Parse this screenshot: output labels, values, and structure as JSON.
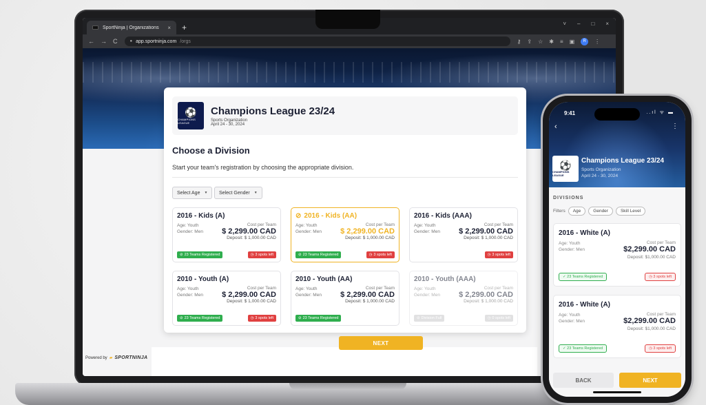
{
  "browser": {
    "tab_title": "SportNinja | Organizations",
    "tab_close": "×",
    "new_tab": "+",
    "url_host": "app.sportninja.com",
    "url_path": "/orgs",
    "nav": {
      "back": "←",
      "forward": "→",
      "reload": "C"
    },
    "window_controls": {
      "chevron": "˅",
      "minimize": "–",
      "maximize": "□",
      "close": "×"
    },
    "profile_initial": "R"
  },
  "org": {
    "title": "Champions League 23/24",
    "type": "Sports Organization",
    "dates": "April 24 - 30, 2024",
    "logo_text": "CHAMPIONS LEAGUE",
    "phone_logo_text": "CHAMPIONS LEAGUE"
  },
  "desktop": {
    "heading": "Choose a Division",
    "subheading": "Start your team's registration by choosing the appropriate division.",
    "filters": [
      {
        "label": "Select Age"
      },
      {
        "label": "Select Gender"
      }
    ],
    "divisions": [
      {
        "name": "2016 - Kids (A)",
        "age": "Age: Youth",
        "gender": "Gender: Men",
        "cost_label": "Cost per Team",
        "price": "$ 2,299.00 CAD",
        "deposit": "Deposit: $ 1,000.00 CAD",
        "teams_badge": "23 Teams Registered",
        "spots_badge": "3 spots left"
      },
      {
        "name": "2016 - Kids (AA)",
        "age": "Age: Youth",
        "gender": "Gender: Men",
        "cost_label": "Cost per Team",
        "price": "$ 2,299.00 CAD",
        "deposit": "Deposit: $ 1,000.00 CAD",
        "teams_badge": "23 Teams Registered",
        "spots_badge": "3 spots left"
      },
      {
        "name": "2016 - Kids (AAA)",
        "age": "Age: Youth",
        "gender": "Gender: Men",
        "cost_label": "Cost per Team",
        "price": "$ 2,299.00 CAD",
        "deposit": "Deposit: $ 1,000.00 CAD",
        "teams_badge": "",
        "spots_badge": "3 spots left"
      },
      {
        "name": "2010 - Youth (A)",
        "age": "Age: Youth",
        "gender": "Gender: Men",
        "cost_label": "Cost per Team",
        "price": "$ 2,299.00 CAD",
        "deposit": "Deposit: $ 1,000.00 CAD",
        "teams_badge": "23 Teams Registered",
        "spots_badge": "3 spots left"
      },
      {
        "name": "2010 - Youth (AA)",
        "age": "Age: Youth",
        "gender": "Gender: Men",
        "cost_label": "Cost per Team",
        "price": "$ 2,299.00 CAD",
        "deposit": "Deposit: $ 1,000.00 CAD",
        "teams_badge": "23 Teams Registered",
        "spots_badge": ""
      },
      {
        "name": "2010 - Youth (AAA)",
        "age": "Age: Youth",
        "gender": "Gender: Men",
        "cost_label": "Cost per Team",
        "price": "$ 2,299.00 CAD",
        "deposit": "Deposit: $ 1,000.00 CAD",
        "teams_badge": "Division Full",
        "spots_badge": "0 spots left"
      }
    ],
    "next_label": "NEXT",
    "powered_by": "Powered by",
    "brand": "SPORTNINJA"
  },
  "phone": {
    "time": "9:41",
    "status": "..ıl ᯤ ▬",
    "back_icon": "‹",
    "more_icon": "⋮",
    "divisions_label": "DIVISIONS",
    "filters_label": "Filters",
    "chips": [
      "Age",
      "Gender",
      "Skill Level"
    ],
    "cards": [
      {
        "name": "2016 - White (A)",
        "age": "Age: Youth",
        "gender": "Gender: Men",
        "cost_label": "Cost per Team",
        "price": "$2,299.00 CAD",
        "deposit": "Deposit: $1,000.00 CAD",
        "teams_badge": "✓ 23 Teams Registered",
        "spots_badge": "◷ 3 spots left"
      },
      {
        "name": "2016 - White (A)",
        "age": "Age: Youth",
        "gender": "Gender: Men",
        "cost_label": "Cost per Team",
        "price": "$2,299.00 CAD",
        "deposit": "Deposit: $1,000.00 CAD",
        "teams_badge": "✓ 23 Teams Registered",
        "spots_badge": "◷ 3 spots left"
      }
    ],
    "back_label": "BACK",
    "next_label": "NEXT"
  },
  "colors": {
    "accent": "#f0b323",
    "green": "#2fae4e",
    "red": "#e04040",
    "navy": "#1c2033"
  }
}
